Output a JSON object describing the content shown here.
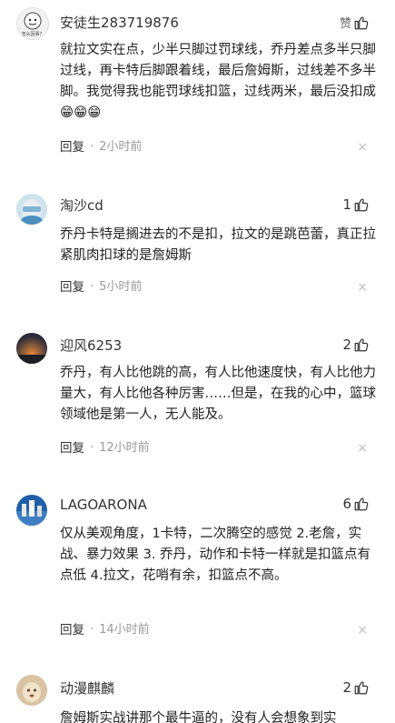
{
  "comments": [
    {
      "username": "安徒生283719876",
      "like_label": "赞",
      "text": "就拉文实在点，少半只脚过罚球线，乔丹差点多半只脚过线，再卡特后脚跟着线，最后詹姆斯，过线差不多半脚。我觉得我也能罚球线扣篮，过线两米，最后没扣成😁😁😁",
      "reply_label": "回复",
      "dot": "·",
      "time": "2小时前",
      "avatar_caption": "怎么回事？",
      "close_glyph": "×"
    },
    {
      "username": "淘沙cd",
      "like_count": "1",
      "text": "乔丹卡特是搁进去的不是扣，拉文的是跳芭蕾，真正拉紧肌肉扣球的是詹姆斯",
      "reply_label": "回复",
      "dot": "·",
      "time": "5小时前",
      "close_glyph": "×"
    },
    {
      "username": "迎风6253",
      "like_count": "2",
      "text": "乔丹，有人比他跳的高，有人比他速度快，有人比他力量大，有人比他各种厉害……但是，在我的心中，篮球领域他是第一人，无人能及。",
      "reply_label": "回复",
      "dot": "·",
      "time": "12小时前",
      "close_glyph": "×"
    },
    {
      "username": "LAGOARONA",
      "like_count": "6",
      "text": "仅从美观角度，1卡特，二次腾空的感觉 2.老詹，实战、暴力效果 3. 乔丹，动作和卡特一样就是扣篮点有点低 4.拉文，花哨有余，扣篮点不高。",
      "reply_label": "回复",
      "dot": "·",
      "time": "14小时前",
      "close_glyph": "×"
    },
    {
      "username": "动漫麒麟",
      "like_count": "2",
      "text": "詹姆斯实战讲那个最牛逼的，没有人会想象到实"
    }
  ],
  "colors": {
    "text": "#222222",
    "meta": "#999999",
    "background": "#ffffff"
  }
}
